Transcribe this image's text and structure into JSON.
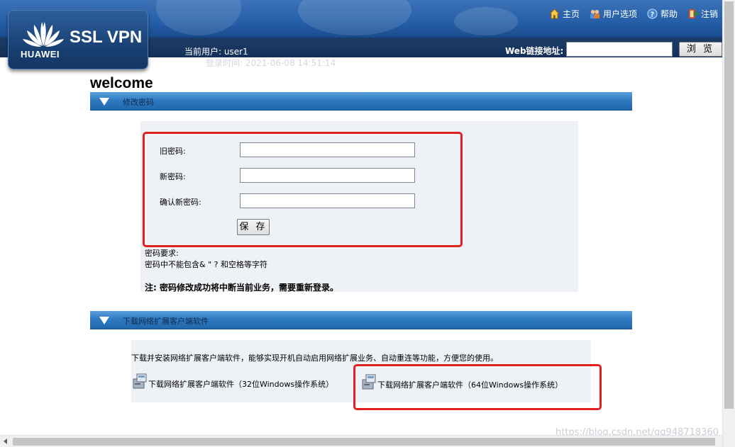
{
  "header": {
    "brand": "HUAWEI",
    "product": "SSL VPN",
    "links": [
      {
        "label": "主页",
        "icon": "home-icon"
      },
      {
        "label": "用户选项",
        "icon": "users-icon"
      },
      {
        "label": "帮助",
        "icon": "help-icon"
      },
      {
        "label": "注销",
        "icon": "logout-icon"
      }
    ],
    "current_user": "当前用户: user1",
    "login_time": "登录时间: 2021-06-08  14:51:14",
    "web_label": "Web链接地址:",
    "web_value": "",
    "browse_label": "浏 览"
  },
  "welcome": "welcome",
  "password_section": {
    "title": "修改密码",
    "old_label": "旧密码:",
    "new_label": "新密码:",
    "confirm_label": "确认新密码:",
    "old_value": "",
    "new_value": "",
    "confirm_value": "",
    "save_label": "保 存",
    "req_title": "密码要求:",
    "req_text": "密码中不能包含& \" ? 和空格等字符",
    "note": "注:  密码修改成功将中断当前业务，需要重新登录。"
  },
  "download_section": {
    "title": "下载网络扩展客户端软件",
    "description": "下载并安装网络扩展客户端软件，能够实现开机自动启用网络扩展业务、自动重连等功能，方便您的使用。",
    "link_32": "下载网络扩展客户端软件（32位Windows操作系统）",
    "link_64": "下载网络扩展客户端软件（64位Windows操作系统）"
  },
  "watermark": "https://blog.csdn.net/qq948718360",
  "colors": {
    "accent": "#2f7bc3",
    "highlight": "#e32020",
    "header": "#1a4c8f"
  }
}
